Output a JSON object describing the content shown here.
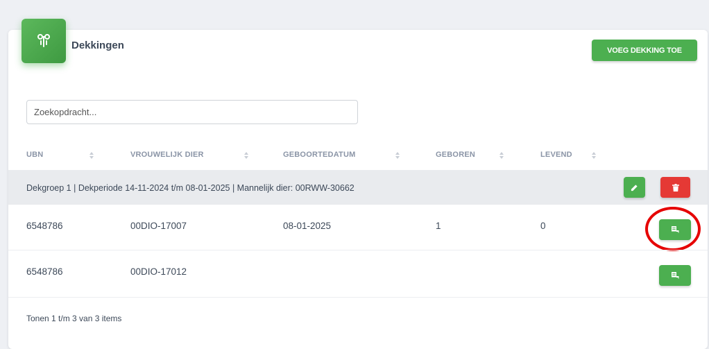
{
  "header": {
    "title": "Dekkingen",
    "icon": "breeding-icon",
    "add_button_label": "VOEG DEKKING TOE"
  },
  "search": {
    "placeholder": "Zoekopdracht...",
    "value": ""
  },
  "table": {
    "columns": [
      "UBN",
      "VROUWELIJK DIER",
      "GEBOORTEDATUM",
      "GEBOREN",
      "LEVEND"
    ],
    "group": {
      "label": "Dekgroep 1 | Dekperiode 14-11-2024 t/m 08-01-2025 | Mannelijk dier: 00RWW-30662"
    },
    "rows": [
      {
        "ubn": "6548786",
        "animal": "00DIO-17007",
        "birth_date": "08-01-2025",
        "born": "1",
        "alive": "0"
      },
      {
        "ubn": "6548786",
        "animal": "00DIO-17012",
        "birth_date": "",
        "born": "",
        "alive": ""
      }
    ]
  },
  "footer": {
    "summary": "Tonen 1 t/m 3 van 3 items"
  },
  "colors": {
    "accent_green": "#4caf50",
    "danger_red": "#e53935",
    "highlight_red": "#e60000",
    "group_row_bg": "#e9ebee"
  }
}
